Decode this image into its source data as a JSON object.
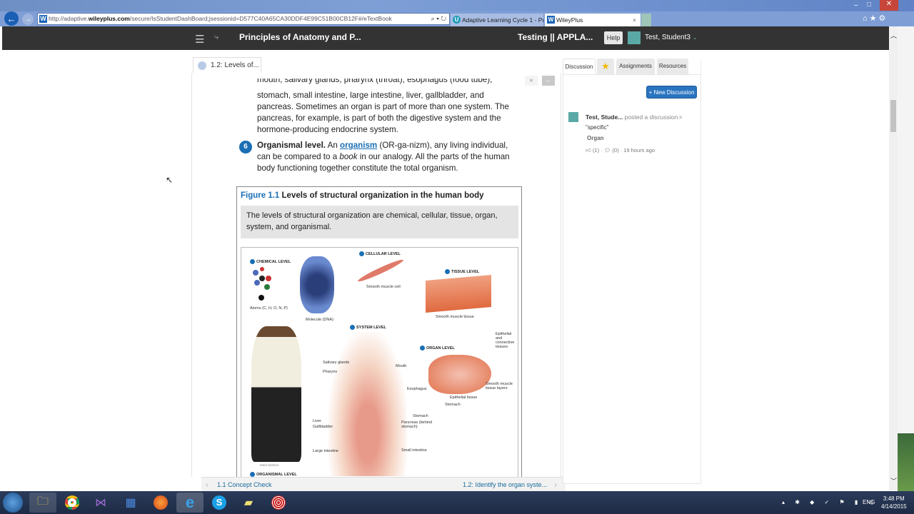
{
  "browser": {
    "url_prefix": "http://adaptive.",
    "url_domain": "wileyplus.com",
    "url_rest": "/secure/IsStudentDashBoard;jsessionid=D577C40A65CA30DDF4E99C51B00CB12F#/eTextBook",
    "tabs": [
      {
        "label": "Adaptive Learning Cycle 1 - Pri...",
        "icon": "U"
      },
      {
        "label": "WileyPlus",
        "icon": "W"
      }
    ],
    "tab_close": "×",
    "site_icon": "W"
  },
  "app": {
    "book_title": "Principles of Anatomy and P...",
    "course_title": "Testing || APPLA...",
    "help": "Help",
    "user": "Test, Student3"
  },
  "reader": {
    "tab_label": "1.2: Levels of...",
    "para_top_cut": "mouth, salivary glands, pharynx (throat), esophagus (food tube),",
    "para_top": "stomach, small intestine, large intestine, liver, gallbladder, and pancreas. Sometimes an organ is part of more than one system. The pancreas, for example, is part of both the digestive system and the hormone-producing endocrine system.",
    "item6": {
      "num": "6",
      "heading": "Organismal level.",
      "t1": " An ",
      "link": "organism",
      "t2": " (OR-ga-nizm), any living individual, can be compared to a ",
      "em": "book",
      "t3": " in our analogy. All the parts of the human body functioning together constitute the total organism."
    },
    "figure": {
      "label": "Figure 1.1",
      "title": " Levels of structural organization in the human body",
      "caption": "The levels of structural organization are chemical, cellular, tissue, organ, system, and organismal.",
      "levels": [
        "CHEMICAL LEVEL",
        "CELLULAR LEVEL",
        "TISSUE LEVEL",
        "ORGAN LEVEL",
        "SYSTEM LEVEL",
        "ORGANISMAL LEVEL"
      ],
      "labels": {
        "atoms": "Atoms (C, H, O, N, P)",
        "dna": "Molecule (DNA)",
        "cell": "Smooth muscle cell",
        "tissue": "Smooth muscle tissue",
        "epi_conn": "Epithelial and connective tissues",
        "muscle_layers": "Smooth muscle tissue layers",
        "epi": "Epithelial tissue",
        "stomach_org": "Stomach",
        "salivary": "Salivary glands",
        "pharynx": "Pharynx",
        "mouth": "Mouth",
        "esophagus": "Esophagus",
        "stomach": "Stomach",
        "pancreas": "Pancreas (behind stomach)",
        "liver": "Liver",
        "gallbladder": "Gallbladder",
        "large_int": "Large intestine",
        "small_int": "Small intestine",
        "credit": "Mark Nielsen"
      }
    },
    "prev": "1.1 Concept Check",
    "next": "1.2: Identify the organ syste..."
  },
  "panel": {
    "tabs": [
      "Discussion",
      "Assignments",
      "Resources"
    ],
    "new_discussion": "+ New Discussion",
    "post": {
      "author": "Test, Stude...",
      "action": "posted a discussion",
      "quote": "\"specific\"",
      "topic": "Organ",
      "likes": "(1)",
      "comments": "(0)",
      "time": "19 hours ago"
    }
  },
  "taskbar": {
    "time": "3:48 PM",
    "date": "4/14/2015",
    "lang": "ENG"
  },
  "colors": {
    "accent": "#1a6fb5",
    "appbar": "#333333",
    "button": "#2a74c0"
  }
}
